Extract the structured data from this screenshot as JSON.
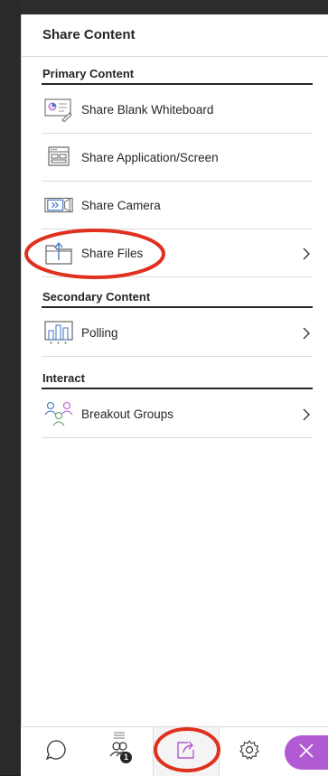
{
  "panel": {
    "title": "Share Content"
  },
  "sections": {
    "primary": {
      "header": "Primary Content",
      "items": [
        {
          "label": "Share Blank Whiteboard",
          "icon": "whiteboard-icon",
          "has_chevron": false
        },
        {
          "label": "Share Application/Screen",
          "icon": "application-screen-icon",
          "has_chevron": false
        },
        {
          "label": "Share Camera",
          "icon": "camera-icon",
          "has_chevron": false
        },
        {
          "label": "Share Files",
          "icon": "files-icon",
          "has_chevron": true
        }
      ]
    },
    "secondary": {
      "header": "Secondary Content",
      "items": [
        {
          "label": "Polling",
          "icon": "polling-icon",
          "has_chevron": true
        }
      ]
    },
    "interact": {
      "header": "Interact",
      "items": [
        {
          "label": "Breakout Groups",
          "icon": "breakout-groups-icon",
          "has_chevron": true
        }
      ]
    }
  },
  "bottom_bar": {
    "tabs": [
      {
        "name": "chat",
        "icon": "chat-icon"
      },
      {
        "name": "attendees",
        "icon": "attendees-icon",
        "badge": "1"
      },
      {
        "name": "share-content",
        "icon": "share-icon",
        "active": true
      },
      {
        "name": "settings",
        "icon": "gear-icon"
      }
    ],
    "close_icon": "close-icon"
  },
  "colors": {
    "accent_purple": "#b05bd3",
    "annotation_red": "#e0301e",
    "icon_blue": "#3b73c4",
    "text": "#262626"
  }
}
